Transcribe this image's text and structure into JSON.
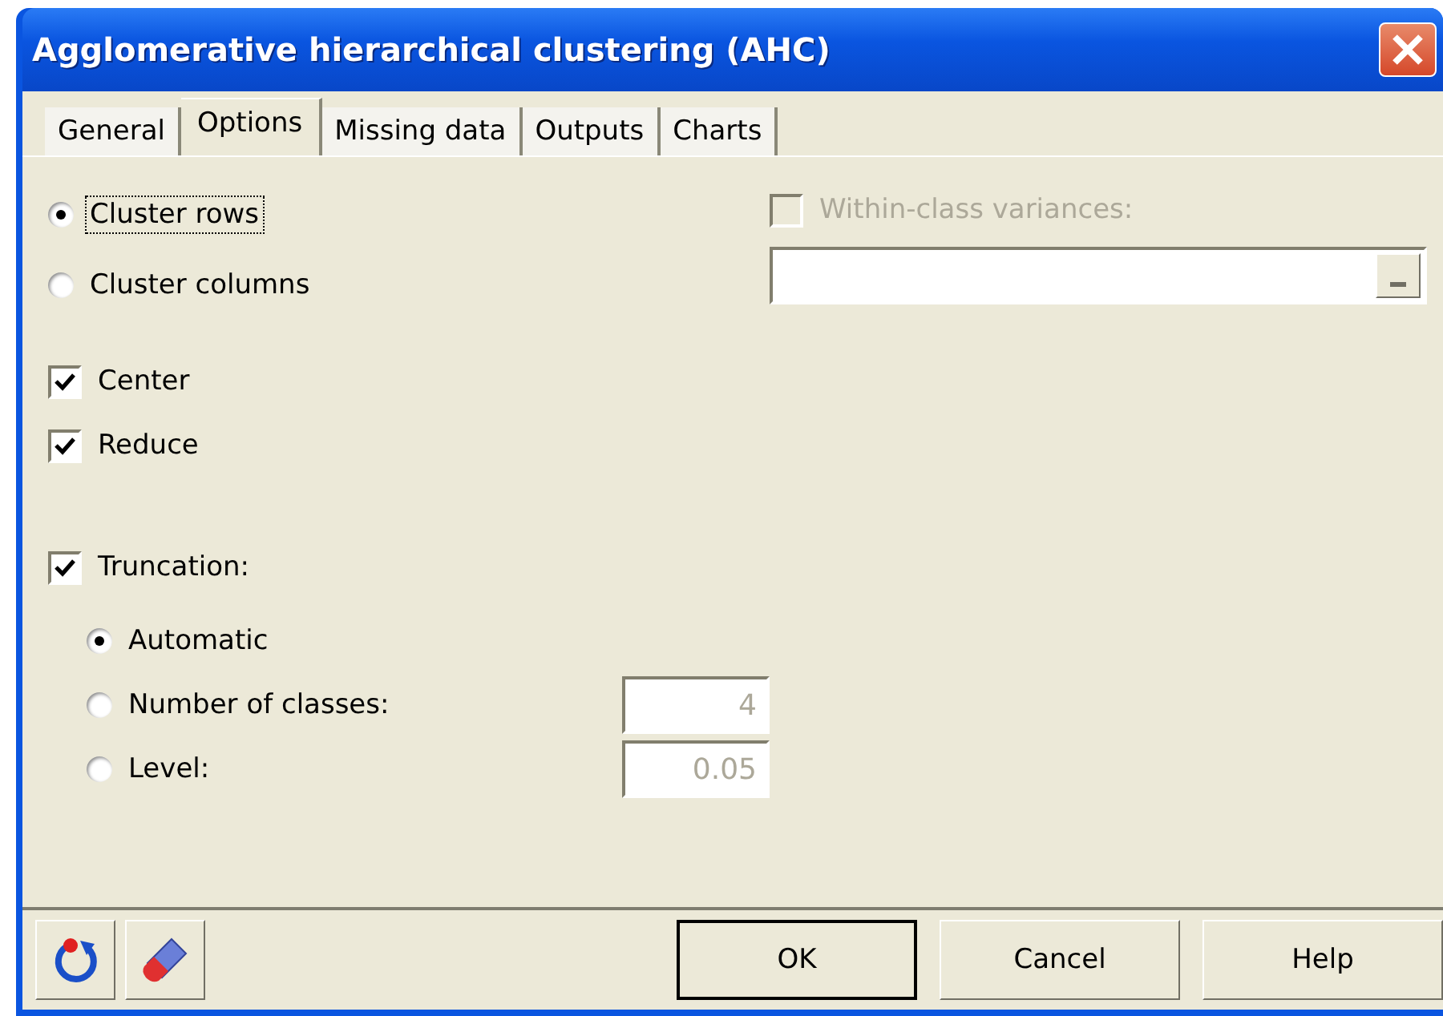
{
  "window": {
    "title": "Agglomerative hierarchical clustering (AHC)"
  },
  "tabs": [
    {
      "label": "General",
      "selected": false
    },
    {
      "label": "Options",
      "selected": true
    },
    {
      "label": "Missing data",
      "selected": false
    },
    {
      "label": "Outputs",
      "selected": false
    },
    {
      "label": "Charts",
      "selected": false
    }
  ],
  "cluster": [
    {
      "label": "Cluster rows",
      "selected": true,
      "focused": true
    },
    {
      "label": "Cluster columns",
      "selected": false,
      "focused": false
    }
  ],
  "within_class": {
    "label": "Within-class variances:",
    "checked": false,
    "disabled": true
  },
  "standardize": [
    {
      "label": "Center",
      "checked": true
    },
    {
      "label": "Reduce",
      "checked": true
    }
  ],
  "truncation": {
    "label": "Truncation:",
    "checked": true,
    "methods": [
      {
        "label": "Automatic",
        "selected": true
      },
      {
        "label": "Number of classes:",
        "selected": false,
        "value": "4"
      },
      {
        "label": "Level:",
        "selected": false,
        "value": "0.05"
      }
    ]
  },
  "buttons": [
    {
      "label": "OK",
      "default": true
    },
    {
      "label": "Cancel",
      "default": false
    },
    {
      "label": "Help",
      "default": false
    }
  ]
}
